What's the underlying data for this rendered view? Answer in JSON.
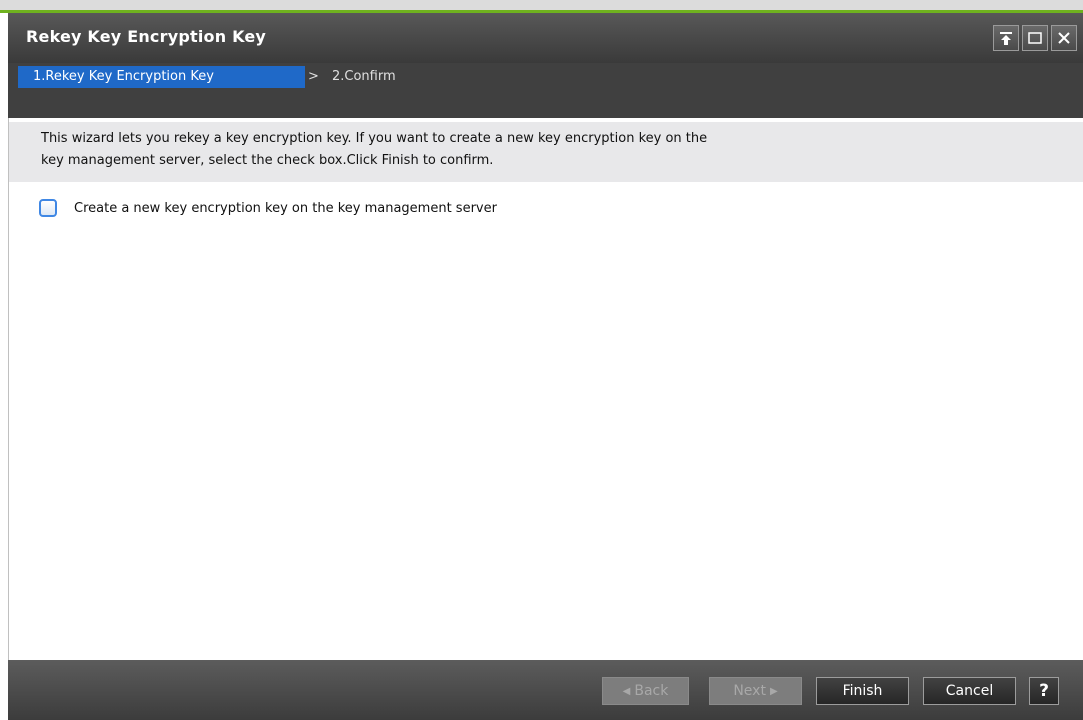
{
  "window": {
    "title": "Rekey Key Encryption Key"
  },
  "wizard": {
    "steps": [
      {
        "label": "1.Rekey Key Encryption Key",
        "active": true
      },
      {
        "label": "2.Confirm",
        "active": false
      }
    ],
    "separator": ">"
  },
  "description": {
    "line1": "This wizard lets you rekey a key encryption key. If you want to create a new key encryption key on the",
    "line2": "key management server, select the check box.Click Finish to confirm."
  },
  "option": {
    "label": "Create a new key encryption key on the key management server",
    "checked": false
  },
  "footer": {
    "back_label": "Back",
    "next_label": "Next",
    "finish_label": "Finish",
    "cancel_label": "Cancel",
    "help_label": "?"
  },
  "colors": {
    "accent_green": "#6fb21f",
    "active_step_blue": "#1f69c8",
    "checkbox_border": "#3f87e4"
  },
  "icons": [
    "pin-icon",
    "maximize-icon",
    "close-icon",
    "back-arrow-icon",
    "next-arrow-icon"
  ]
}
